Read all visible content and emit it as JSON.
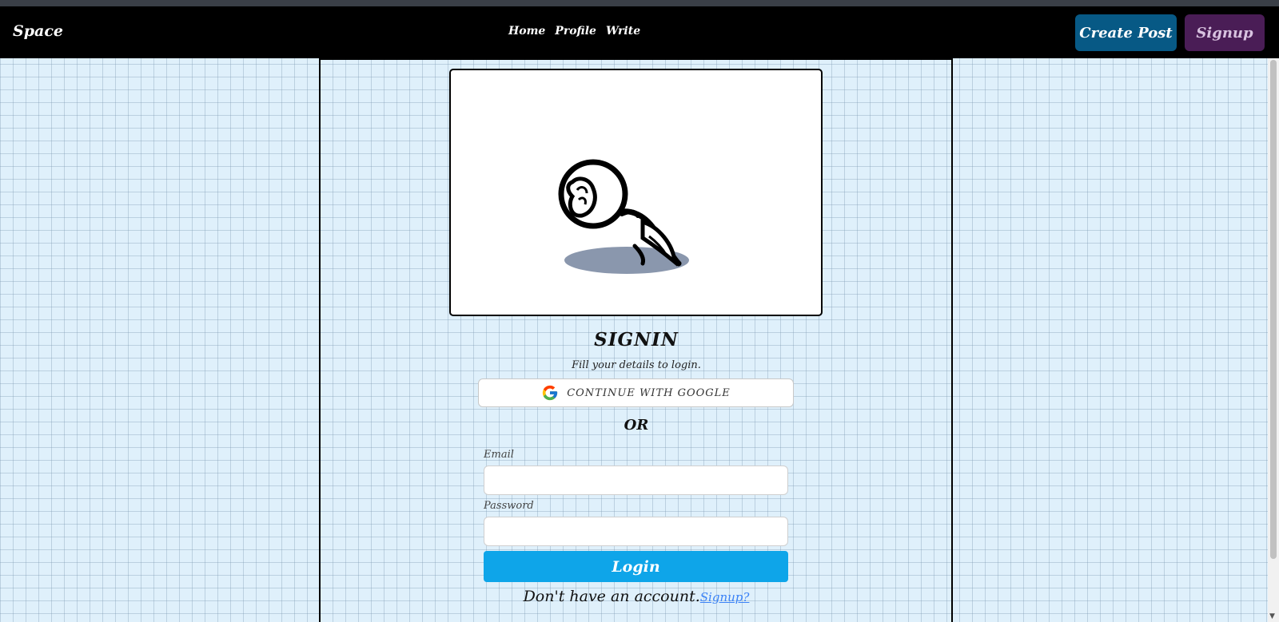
{
  "nav": {
    "brand": "Space",
    "links": [
      "Home",
      "Profile",
      "Write"
    ],
    "create_post": "Create Post",
    "signup": "Signup"
  },
  "auth": {
    "title": "SIGNIN",
    "subtitle": "Fill your details to login.",
    "google_label": "CONTINUE WITH GOOGLE",
    "or_label": "OR",
    "email_label": "Email",
    "email_value": "",
    "password_label": "Password",
    "password_value": "",
    "login_label": "Login",
    "no_account_text": "Don't have an account.",
    "signup_link": "Signup?"
  },
  "colors": {
    "accent": "#0ea5e9",
    "create_post_bg": "#075985",
    "signup_bg": "#4a1d56",
    "page_bg": "#dff0fb"
  },
  "icons": {
    "google": "google-g-icon",
    "illustration": "sad-character-illustration"
  }
}
